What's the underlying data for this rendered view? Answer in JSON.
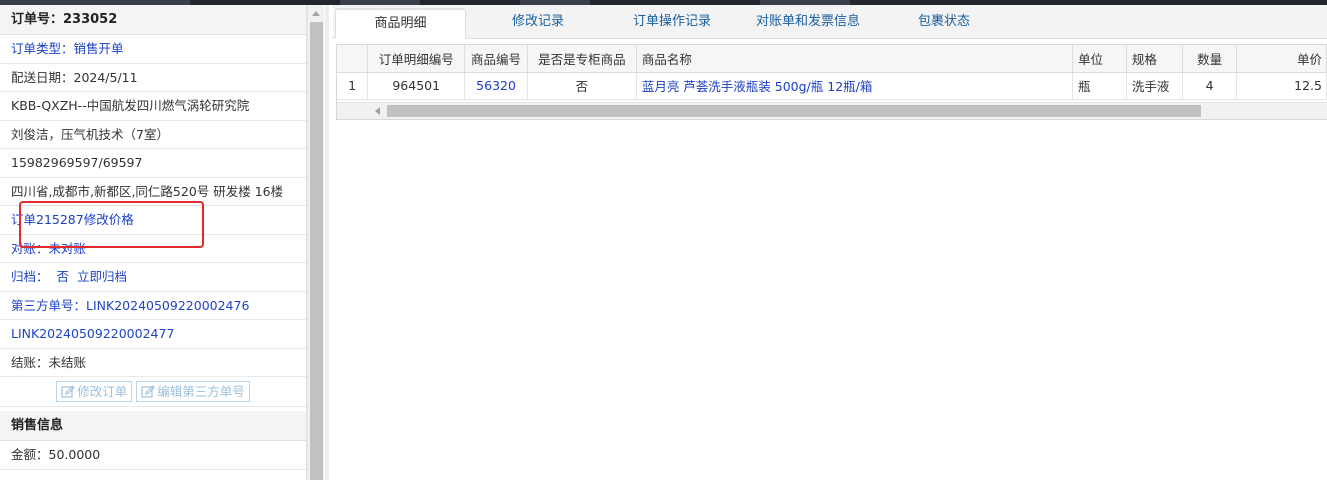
{
  "order": {
    "header": "订单号：233052",
    "type_label": "订单类型：",
    "type_value": "销售开单",
    "delivery_date": "配送日期：2024/5/11",
    "customer": "KBB-QXZH--中国航发四川燃气涡轮研究院",
    "contact": "刘俊洁，压气机技术（7室）",
    "phone": "15982969597/69597",
    "address": "四川省,成都市,新都区,同仁路520号 研发楼 16楼",
    "price_change_link": "订单215287修改价格",
    "reconcile_label": "对账：",
    "reconcile_value": "未对账",
    "archive_label": "归档：",
    "archive_value": "否",
    "archive_action": "立即归档",
    "third_party_label": "第三方单号：",
    "third_party_1": "LINK20240509220002476",
    "third_party_2": "LINK20240509220002477",
    "settle": "结账：未结账",
    "edit_order_button": "修改订单",
    "edit_third_party_button": "编辑第三方单号"
  },
  "sales": {
    "header": "销售信息",
    "amount": "金额：50.0000"
  },
  "tabs": [
    {
      "label": "商品明细",
      "active": true
    },
    {
      "label": "修改记录",
      "active": false
    },
    {
      "label": "订单操作记录",
      "active": false
    },
    {
      "label": "对账单和发票信息",
      "active": false
    },
    {
      "label": "包裹状态",
      "active": false
    }
  ],
  "grid": {
    "columns": [
      "",
      "订单明细编号",
      "商品编号",
      "是否是专柜商品",
      "商品名称",
      "单位",
      "规格",
      "数量",
      "单价"
    ],
    "rows": [
      {
        "index": "1",
        "detail_id": "964501",
        "product_id": "56320",
        "is_counter": "否",
        "name": "蓝月亮 芦荟洗手液瓶装 500g/瓶 12瓶/箱",
        "unit": "瓶",
        "spec": "洗手液",
        "qty": "4",
        "price": "12.5"
      }
    ]
  },
  "colors": {
    "link_blue": "#1a3fc4",
    "tab_text": "#1a5e9e",
    "highlight_red": "#e32b2b"
  },
  "icons": {
    "edit": "pencil-square-icon"
  }
}
